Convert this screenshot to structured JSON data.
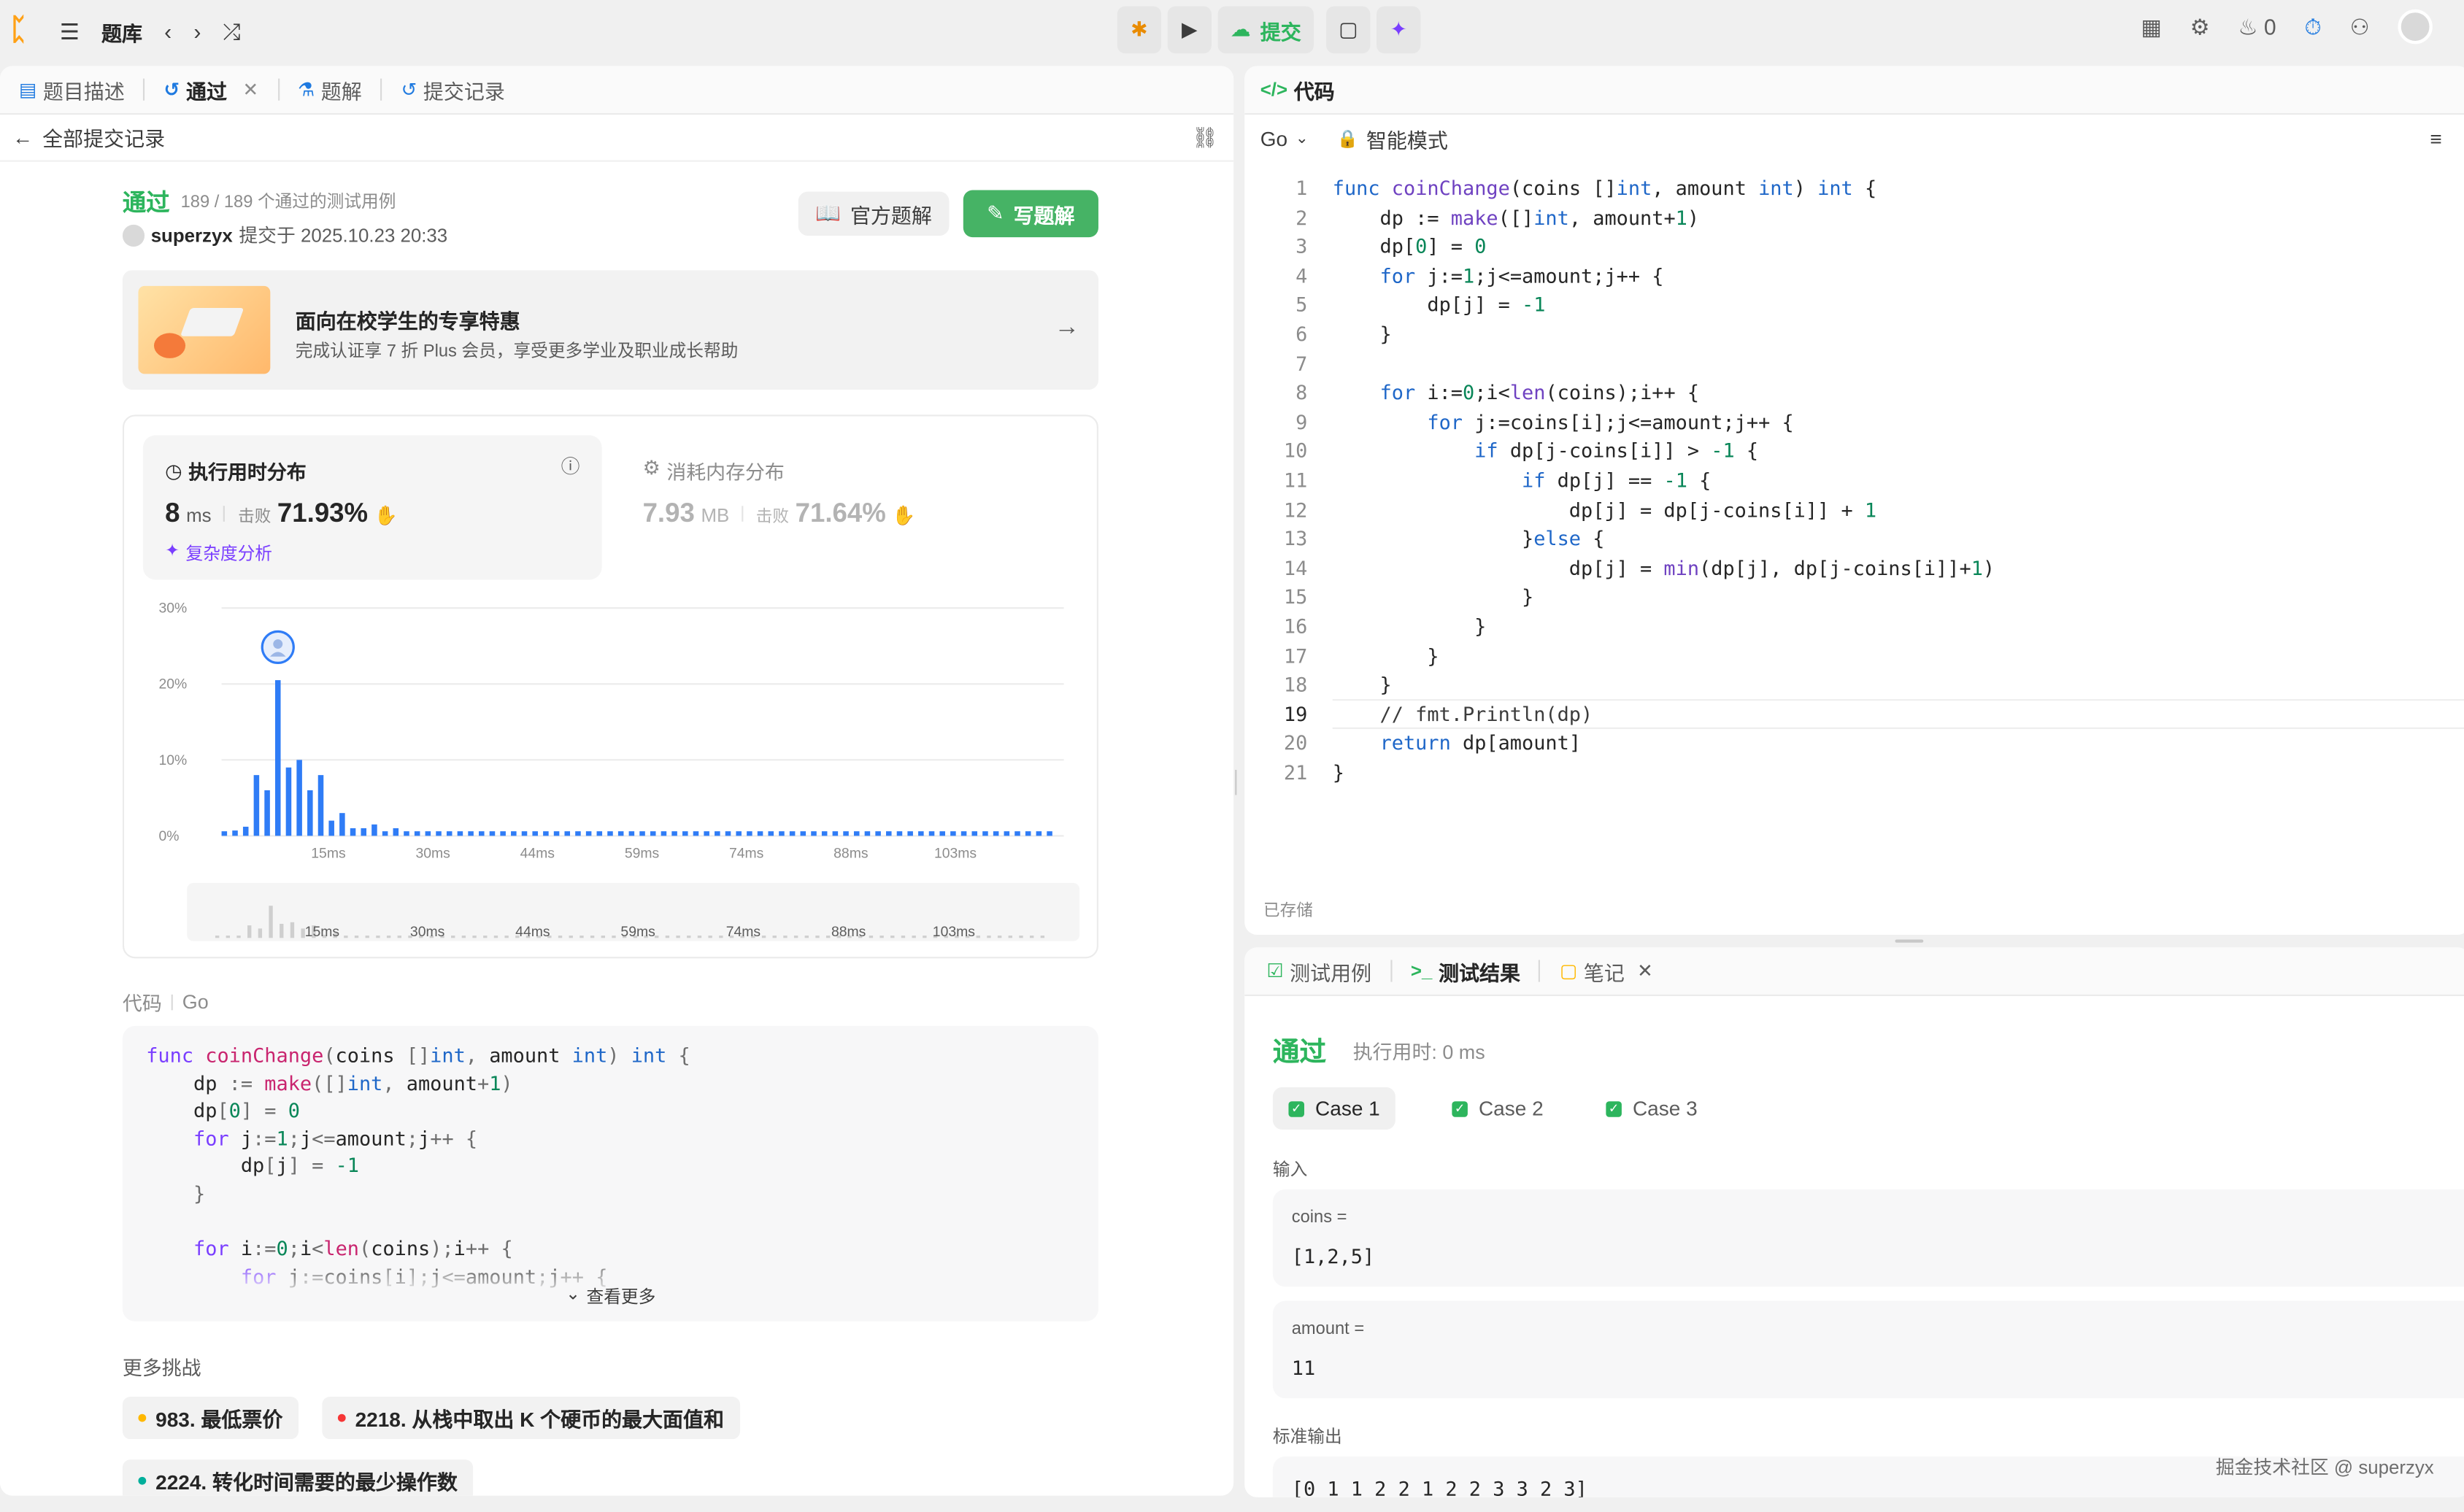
{
  "topbar": {
    "title": "题库",
    "submit": "提交",
    "streak": "0"
  },
  "left_tabs": [
    {
      "label": "题目描述"
    },
    {
      "label": "通过"
    },
    {
      "label": "题解"
    },
    {
      "label": "提交记录"
    }
  ],
  "back_label": "全部提交记录",
  "result": {
    "status": "通过",
    "cases": "189 / 189 个通过的测试用例",
    "user": "superzyx",
    "submitted": "提交于 2025.10.23 20:33",
    "official_btn": "官方题解",
    "write_btn": "写题解"
  },
  "banner": {
    "title": "面向在校学生的专享特惠",
    "sub": "完成认证享 7 折 Plus 会员，享受更多学业及职业成长帮助"
  },
  "runtime": {
    "title": "执行用时分布",
    "value": "8",
    "unit": "ms",
    "beats_label": "击败",
    "beats": "71.93%",
    "analysis": "复杂度分析"
  },
  "memory": {
    "title": "消耗内存分布",
    "value": "7.93",
    "unit": "MB",
    "beats_label": "击败",
    "beats": "71.64%"
  },
  "chart_data": {
    "type": "bar",
    "y_ticks": [
      "30%",
      "20%",
      "10%",
      "0%"
    ],
    "x_ticks": [
      "15ms",
      "30ms",
      "44ms",
      "59ms",
      "74ms",
      "88ms",
      "103ms"
    ],
    "values": [
      0.6,
      0.7,
      1.2,
      8.0,
      6.0,
      20.5,
      9.0,
      10.0,
      6.0,
      8.0,
      2.0,
      3.0,
      1.0,
      1.0,
      1.5,
      0.6,
      1.0,
      0.6,
      0.6,
      0.6,
      0.6,
      0.6,
      0.6,
      0.6,
      0.6,
      0.6,
      0.6,
      0.6,
      0.6,
      0.6,
      0.6,
      0.6,
      0.6,
      0.6,
      0.6,
      0.6,
      0.6,
      0.6,
      0.6,
      0.6,
      0.6,
      0.6,
      0.6,
      0.6,
      0.6,
      0.6,
      0.6,
      0.6,
      0.6,
      0.6,
      0.6,
      0.6,
      0.6,
      0.6,
      0.6,
      0.6,
      0.6,
      0.6,
      0.6,
      0.6,
      0.6,
      0.6,
      0.6,
      0.6,
      0.6,
      0.6,
      0.6,
      0.6,
      0.6,
      0.6,
      0.6,
      0.6,
      0.6,
      0.6,
      0.6,
      0.6,
      0.6,
      0.6
    ],
    "ylim": [
      0,
      30
    ],
    "highlight_index": 5
  },
  "code_label": "代码",
  "code_lang": "Go",
  "see_more": "查看更多",
  "more_challenges": "更多挑战",
  "challenges": [
    {
      "label": "983. 最低票价",
      "color": "#ffb800"
    },
    {
      "label": "2218. 从栈中取出 K 个硬币的最大面值和",
      "color": "#f63636"
    },
    {
      "label": "2224. 转化时间需要的最少操作数",
      "color": "#00af9b"
    }
  ],
  "code_panel": {
    "title": "代码",
    "lang": "Go",
    "mode": "智能模式",
    "saved": "已存储"
  },
  "code_lines": [
    "func coinChange(coins []int, amount int) int {",
    "    dp := make([]int, amount+1)",
    "    dp[0] = 0",
    "    for j:=1;j<=amount;j++ {",
    "        dp[j] = -1",
    "    }",
    "",
    "    for i:=0;i<len(coins);i++ {",
    "        for j:=coins[i];j<=amount;j++ {",
    "            if dp[j-coins[i]] > -1 {",
    "                if dp[j] == -1 {",
    "                    dp[j] = dp[j-coins[i]] + 1",
    "                }else {",
    "                    dp[j] = min(dp[j], dp[j-coins[i]]+1)",
    "                }",
    "            }",
    "        }",
    "    }",
    "    // fmt.Println(dp)",
    "    return dp[amount]",
    "}"
  ],
  "test_tabs": [
    {
      "label": "测试用例"
    },
    {
      "label": "测试结果"
    },
    {
      "label": "笔记"
    }
  ],
  "test": {
    "status": "通过",
    "runtime": "执行用时: 0 ms",
    "cases": [
      "Case 1",
      "Case 2",
      "Case 3"
    ],
    "input_label": "输入",
    "coins_label": "coins =",
    "coins_value": "[1,2,5]",
    "amount_label": "amount =",
    "amount_value": "11",
    "output_label": "标准输出",
    "output_value": "[0 1 1 2 2 1 2 2 3 3 2 3]"
  },
  "watermark": "掘金技术社区 @ superzyx"
}
